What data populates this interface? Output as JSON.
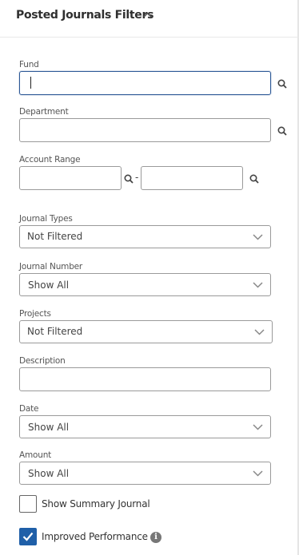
{
  "header": {
    "title": "Posted Journals Filters",
    "toggle_icon": "chevron-up-icon"
  },
  "fields": {
    "fund": {
      "label": "Fund",
      "value": ""
    },
    "department": {
      "label": "Department",
      "value": ""
    },
    "account_range": {
      "label": "Account Range",
      "from": "",
      "to": "",
      "separator": "-"
    },
    "journal_types": {
      "label": "Journal Types",
      "selected": "Not Filtered"
    },
    "journal_number": {
      "label": "Journal Number",
      "selected": "Show All"
    },
    "projects": {
      "label": "Projects",
      "selected": "Not Filtered"
    },
    "description": {
      "label": "Description",
      "value": ""
    },
    "date": {
      "label": "Date",
      "selected": "Show All"
    },
    "amount": {
      "label": "Amount",
      "selected": "Show All"
    }
  },
  "checkboxes": {
    "show_summary": {
      "label": "Show Summary Journal",
      "checked": false
    },
    "improved_performance": {
      "label": "Improved Performance",
      "checked": true,
      "info_icon": "info-icon",
      "info_glyph": "i"
    }
  },
  "colors": {
    "accent": "#1f5fa8",
    "focus_border": "#2c5896",
    "border": "#9a9a9a"
  }
}
